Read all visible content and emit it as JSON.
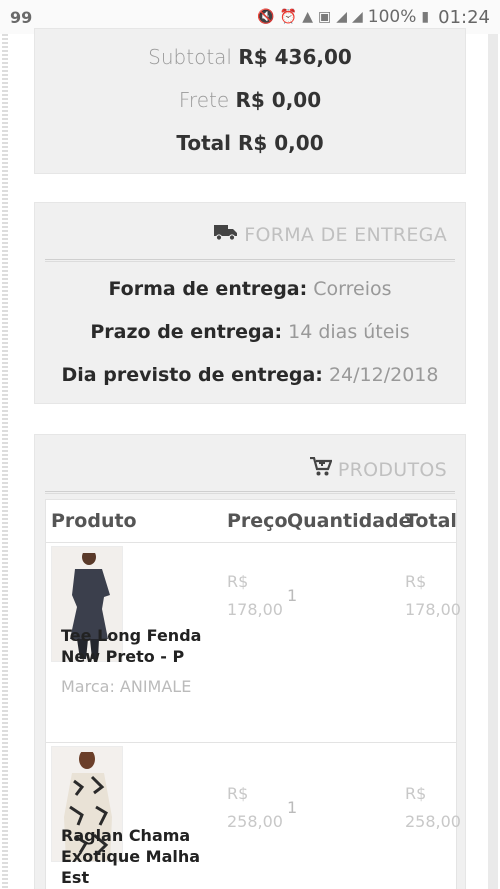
{
  "status_bar": {
    "notification": "99",
    "battery": "100%",
    "time": "01:24"
  },
  "totals": {
    "subtotal_label": "Subtotal",
    "subtotal_value": "R$ 436,00",
    "frete_label": "Frete",
    "frete_value": "R$ 0,00",
    "total_label": "Total",
    "total_value": "R$ 0,00"
  },
  "delivery": {
    "heading": "FORMA DE ENTREGA",
    "method_label": "Forma de entrega:",
    "method_value": "Correios",
    "deadline_label": "Prazo de entrega:",
    "deadline_value": "14 dias úteis",
    "expected_label": "Dia previsto de entrega:",
    "expected_value": "24/12/2018"
  },
  "products": {
    "heading": "PRODUTOS",
    "columns": [
      "Produto",
      "Preço",
      "Quantidade",
      "Total"
    ],
    "items": [
      {
        "name": "Tee Long Fenda New Preto - P",
        "brand": "Marca: ANIMALE",
        "price_currency": "R$",
        "price_amount": "178,00",
        "quantity": "1",
        "total_currency": "R$",
        "total_amount": "178,00"
      },
      {
        "name": "Raglan Chama Exotique Malha Est",
        "price_currency": "R$",
        "price_amount": "258,00",
        "quantity": "1",
        "total_currency": "R$",
        "total_amount": "258,00"
      }
    ]
  },
  "icons": {
    "delivery": "truck-icon",
    "products": "cart-icon"
  }
}
